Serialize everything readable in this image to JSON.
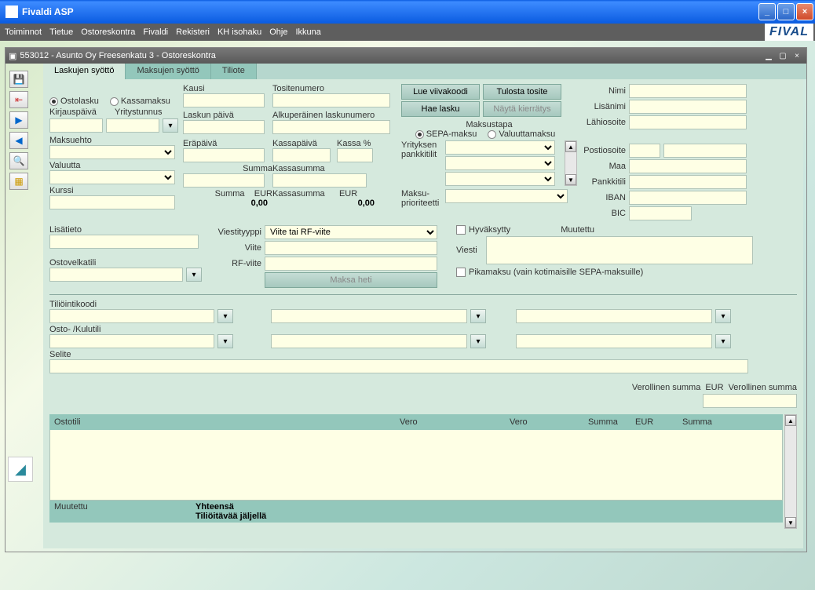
{
  "window": {
    "title": "Fivaldi ASP"
  },
  "brand": "FIVAL",
  "menu": [
    "Toiminnot",
    "Tietue",
    "Ostoreskontra",
    "Fivaldi",
    "Rekisteri",
    "KH isohaku",
    "Ohje",
    "Ikkuna"
  ],
  "inner": {
    "title": "553012 - Asunto Oy Freesenkatu 3 - Ostoreskontra"
  },
  "tabs": [
    "Laskujen syöttö",
    "Maksujen syöttö",
    "Tiliote"
  ],
  "radios": {
    "ostolasku": "Ostolasku",
    "kassamaksu": "Kassamaksu"
  },
  "labels": {
    "kausi": "Kausi",
    "tositenumero": "Tositenumero",
    "kirjauspaiva": "Kirjauspäivä",
    "yritystunnus": "Yritystunnus",
    "laskunpaiva": "Laskun päivä",
    "alkuperainen": "Alkuperäinen laskunumero",
    "maksustapa": "Maksustapa",
    "sepa": "SEPA-maksu",
    "valuutta_r": "Valuuttamaksu",
    "maksuehto": "Maksuehto",
    "erapaiva": "Eräpäivä",
    "kassapaiva": "Kassapäivä",
    "kassapct": "Kassa %",
    "valuutta": "Valuutta",
    "summa": "Summa",
    "kassasumma": "Kassasumma",
    "kurssi": "Kurssi",
    "summa_eur": "Summa    EUR",
    "kassasumma_eur": "Kassasumma      EUR",
    "yrityksen": "Yrityksen pankkitilit",
    "maksuprio": "Maksu-prioriteetti",
    "lisatieto": "Lisätieto",
    "viestityyppi": "Viestityyppi",
    "viite": "Viite",
    "rfviite": "RF-viite",
    "ostovelkatili": "Ostovelkatili",
    "viesti": "Viesti",
    "hyvaksytty": "Hyväksytty",
    "muutettu": "Muutettu",
    "pikamaksu": "Pikamaksu (vain kotimaisille SEPA-maksuille)",
    "nimi": "Nimi",
    "lisanimi": "Lisänimi",
    "lahiosoite": "Lähiosoite",
    "postiosoite": "Postiosoite",
    "maa": "Maa",
    "pankkitili": "Pankkitili",
    "iban": "IBAN",
    "bic": "BIC",
    "tiliointikoodi": "Tiliöintikoodi",
    "ostokulutili": "Osto- /Kulutili",
    "selite": "Selite",
    "verollinen": "Verollinen summa",
    "eur": "EUR",
    "verollinen2": "Verollinen summa",
    "yhteensa": "Yhteensä",
    "tilioitavaa": "Tiliöitävää jäljellä"
  },
  "buttons": {
    "lue": "Lue viivakoodi",
    "tulosta": "Tulosta tosite",
    "hae": "Hae lasku",
    "nayta": "Näytä kierrätys",
    "maksa": "Maksa heti"
  },
  "values": {
    "summa_eur": "0,00",
    "kassasumma_eur": "0,00",
    "viestityyppi_sel": "Viite tai RF-viite"
  },
  "grid": {
    "cols": [
      "Ostotili",
      "Vero",
      "Vero",
      "Summa",
      "EUR",
      "Summa"
    ],
    "muutettu": "Muutettu"
  }
}
